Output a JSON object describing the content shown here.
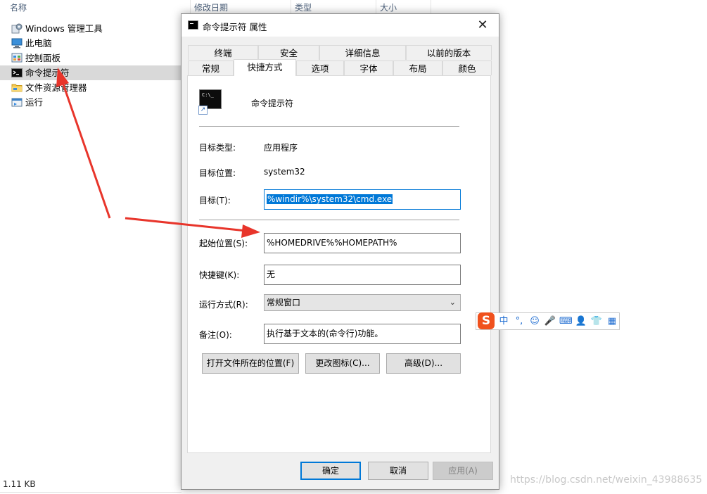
{
  "explorer": {
    "columns": {
      "name": "名称",
      "date": "修改日期",
      "type": "类型",
      "size": "大小"
    },
    "items": [
      {
        "label": "Windows 管理工具",
        "icon": "admin-tools-icon",
        "selected": false
      },
      {
        "label": "此电脑",
        "icon": "computer-icon",
        "selected": false
      },
      {
        "label": "控制面板",
        "icon": "control-panel-icon",
        "selected": false
      },
      {
        "label": "命令提示符",
        "icon": "cmd-icon",
        "selected": true
      },
      {
        "label": "文件资源管理器",
        "icon": "folder-icon",
        "selected": false
      },
      {
        "label": "运行",
        "icon": "run-icon",
        "selected": false
      }
    ],
    "status_size": "1.11 KB"
  },
  "dialog": {
    "title": "命令提示符 属性",
    "close_glyph": "✕",
    "tabs_row1": [
      "终端",
      "安全",
      "详细信息",
      "以前的版本"
    ],
    "tabs_row2": [
      "常规",
      "快捷方式",
      "选项",
      "字体",
      "布局",
      "颜色"
    ],
    "active_tab": "快捷方式",
    "icon_prompt": "C:\\_",
    "icon_shortcut_glyph": "↗",
    "app_name": "命令提示符",
    "target_type": {
      "label": "目标类型:",
      "value": "应用程序"
    },
    "target_location": {
      "label": "目标位置:",
      "value": "system32"
    },
    "target": {
      "label": "目标(T):",
      "value": "%windir%\\system32\\cmd.exe"
    },
    "start_in": {
      "label": "起始位置(S):",
      "value": "%HOMEDRIVE%%HOMEPATH%"
    },
    "shortcut_key": {
      "label": "快捷键(K):",
      "value": "无"
    },
    "run": {
      "label": "运行方式(R):",
      "value": "常规窗口",
      "arrow_glyph": "⌄"
    },
    "comment": {
      "label": "备注(O):",
      "value": "执行基于文本的(命令行)功能。"
    },
    "buttons": {
      "open_location": "打开文件所在的位置(F)",
      "change_icon": "更改图标(C)...",
      "advanced": "高级(D)..."
    },
    "footer": {
      "ok": "确定",
      "cancel": "取消",
      "apply": "应用(A)"
    }
  },
  "ime": {
    "logo": "S",
    "items": [
      "中",
      "°,",
      "☺",
      "🎤",
      "⌨",
      "👤",
      "👕",
      "▦"
    ],
    "accent": "#f0511d"
  },
  "watermark": "https://blog.csdn.net/weixin_43988635",
  "colors": {
    "accent": "#0078d7",
    "arrow": "#e8352b"
  }
}
